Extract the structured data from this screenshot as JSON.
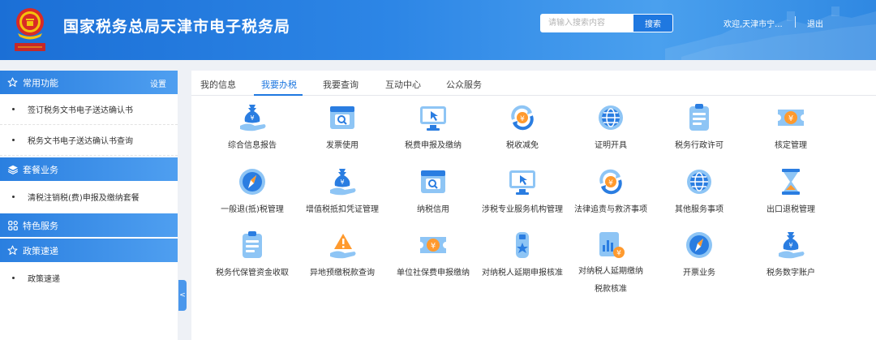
{
  "header": {
    "title": "国家税务总局天津市电子税务局",
    "search_placeholder": "请输入搜索内容",
    "search_button": "搜索",
    "welcome": "欢迎,天津市宁...",
    "logout": "退出"
  },
  "sidebar": {
    "sections": [
      {
        "title": "常用功能",
        "action": "设置",
        "icon": "star-icon",
        "items": [
          "签订税务文书电子送达确认书",
          "税务文书电子送达确认书查询"
        ]
      },
      {
        "title": "套餐业务",
        "icon": "layers-icon",
        "items": [
          "清税注销税(费)申报及缴纳套餐"
        ]
      },
      {
        "title": "特色服务",
        "icon": "grid-icon",
        "items": []
      },
      {
        "title": "政策速递",
        "icon": "star-icon",
        "items": [
          "政策速递"
        ]
      }
    ],
    "collapse_glyph": "<"
  },
  "tabs": [
    "我的信息",
    "我要办税",
    "我要查询",
    "互动中心",
    "公众服务"
  ],
  "active_tab": "我要办税",
  "services": [
    {
      "label": "综合信息报告",
      "icon": "money-bag-hand-icon"
    },
    {
      "label": "发票使用",
      "icon": "invoice-search-icon"
    },
    {
      "label": "税费申报及缴纳",
      "icon": "monitor-cursor-icon"
    },
    {
      "label": "税收减免",
      "icon": "yuan-refresh-icon"
    },
    {
      "label": "证明开具",
      "icon": "globe-badge-icon"
    },
    {
      "label": "税务行政许可",
      "icon": "clipboard-icon"
    },
    {
      "label": "核定管理",
      "icon": "yuan-ticket-icon"
    },
    {
      "label": "一般退(抵)税管理",
      "icon": "compass-icon"
    },
    {
      "label": "增值税抵扣凭证管理",
      "icon": "money-bag-hand-icon"
    },
    {
      "label": "纳税信用",
      "icon": "invoice-search-icon"
    },
    {
      "label": "涉税专业服务机构管理",
      "icon": "monitor-cursor-icon"
    },
    {
      "label": "法律追责与救济事项",
      "icon": "yuan-refresh-icon"
    },
    {
      "label": "其他服务事项",
      "icon": "globe-badge-icon"
    },
    {
      "label": "出口退税管理",
      "icon": "hourglass-icon"
    },
    {
      "label": "税务代保管资金收取",
      "icon": "clipboard-icon"
    },
    {
      "label": "异地预缴税款查询",
      "icon": "warning-hand-icon"
    },
    {
      "label": "单位社保费申报缴纳",
      "icon": "yuan-ticket-icon"
    },
    {
      "label": "对纳税人延期申报核准",
      "icon": "usb-star-icon"
    },
    {
      "label": "对纳税人延期缴纳税款核准",
      "icon": "document-chart-icon"
    },
    {
      "label": "开票业务",
      "icon": "compass-icon"
    },
    {
      "label": "税务数字账户",
      "icon": "money-bag-hand-icon"
    }
  ],
  "colors": {
    "primary": "#1f78e0",
    "header_start": "#1b6fd6",
    "icon_light": "#8ec5f5",
    "icon_dark": "#2a7de1",
    "accent_orange": "#ff9a2e"
  }
}
